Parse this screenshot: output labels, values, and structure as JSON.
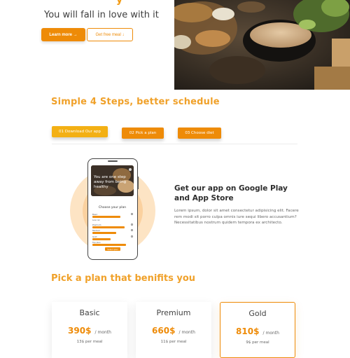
{
  "hero": {
    "title_fragment": "y",
    "tagline": "You will fall in love with it",
    "learn_more": "Learn more →",
    "free_meal": "Get free meal ↓",
    "scroll_top": "+"
  },
  "steps": {
    "title": "Simple 4 Steps, better schedule",
    "tabs": [
      {
        "label": "01 Download Our app"
      },
      {
        "label": "02 Pick a plan"
      },
      {
        "label": "03 Choose diet"
      }
    ]
  },
  "phone": {
    "image_text": "You are one step away from being healthy",
    "plan_title": "Choose your plan",
    "options": [
      "Basic",
      "Low cal",
      "Premium",
      "Medium",
      "Gold",
      "Top plan"
    ],
    "cta": "Select plan"
  },
  "app": {
    "title": "Get our app on Google Play and App Store",
    "description": "Lorem ipsum, dolor sit amet consectetur adipisicing elit. Facere rem modi sit porro culpa omnis iure sequi libero accusantium? Necessitatibus nostrum quidem tempora ex architecto."
  },
  "plans": {
    "title": "Pick a plan that benifits you",
    "items": [
      {
        "name": "Basic",
        "price": "390$",
        "period": "/ month",
        "meal": "13$ per meal"
      },
      {
        "name": "Premium",
        "price": "660$",
        "period": "/ month",
        "meal": "11$ per meal"
      },
      {
        "name": "Gold",
        "price": "810$",
        "period": "/ month",
        "meal": "9$ per meal"
      }
    ]
  },
  "colors": {
    "accent": "#ee8b08",
    "accent_light": "#f3b014",
    "heading": "#f0a12a"
  }
}
